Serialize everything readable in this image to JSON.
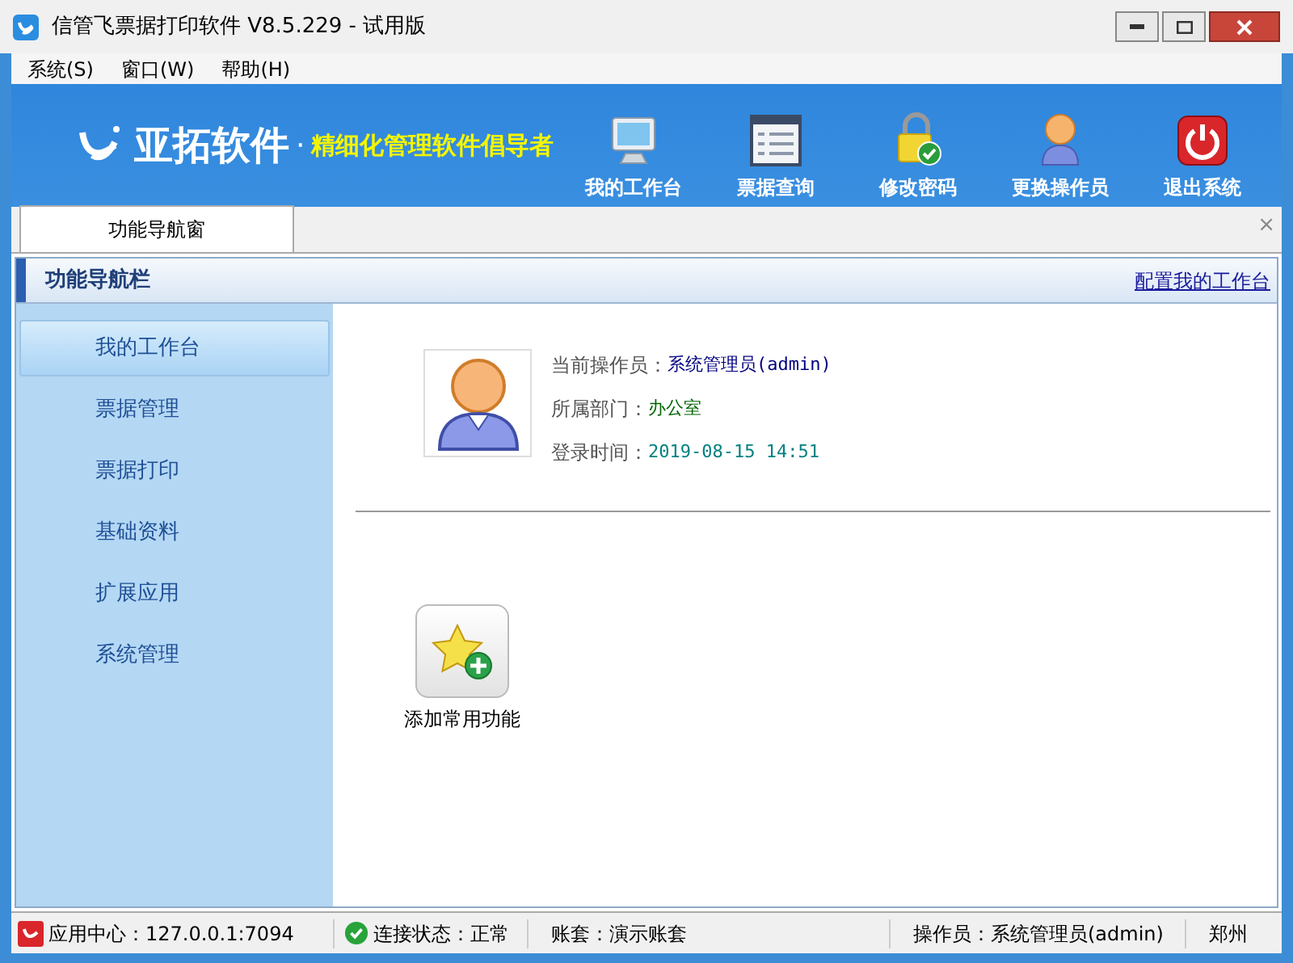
{
  "window": {
    "title": "信管飞票据打印软件 V8.5.229 - 试用版"
  },
  "menu": [
    "系统(S)",
    "窗口(W)",
    "帮助(H)"
  ],
  "banner": {
    "brand": "亚拓软件",
    "dot": "·",
    "slogan": "精细化管理软件倡导者"
  },
  "toolbar": [
    {
      "kind": "monitor",
      "label": "我的工作台"
    },
    {
      "kind": "list",
      "label": "票据查询"
    },
    {
      "kind": "lock",
      "label": "修改密码"
    },
    {
      "kind": "user",
      "label": "更换操作员"
    },
    {
      "kind": "power",
      "label": "退出系统"
    }
  ],
  "tabs": [
    {
      "label": "功能导航窗",
      "selected": true
    }
  ],
  "tab_close": "×",
  "panel": {
    "title": "功能导航栏",
    "link": "配置我的工作台"
  },
  "sidebar": {
    "items": [
      {
        "label": "我的工作台",
        "selected": true
      },
      {
        "label": "票据管理",
        "selected": false
      },
      {
        "label": "票据打印",
        "selected": false
      },
      {
        "label": "基础资料",
        "selected": false
      },
      {
        "label": "扩展应用",
        "selected": false
      },
      {
        "label": "系统管理",
        "selected": false
      }
    ]
  },
  "profile": {
    "fields": [
      {
        "label": "当前操作员：",
        "value": "系统管理员(admin)",
        "color": "#000080"
      },
      {
        "label": "所属部门：",
        "value": "办公室",
        "color": "#006400"
      },
      {
        "label": "登录时间：",
        "value": "2019-08-15 14:51",
        "color": "#008080"
      }
    ]
  },
  "shortcuts": [
    {
      "label": "添加常用功能"
    }
  ],
  "status_bar": {
    "server": "应用中心：127.0.0.1:7094",
    "connection": "连接状态：正常",
    "account": "账套：演示账套",
    "operator": "操作员：系统管理员(admin)",
    "extra": "郑州"
  }
}
